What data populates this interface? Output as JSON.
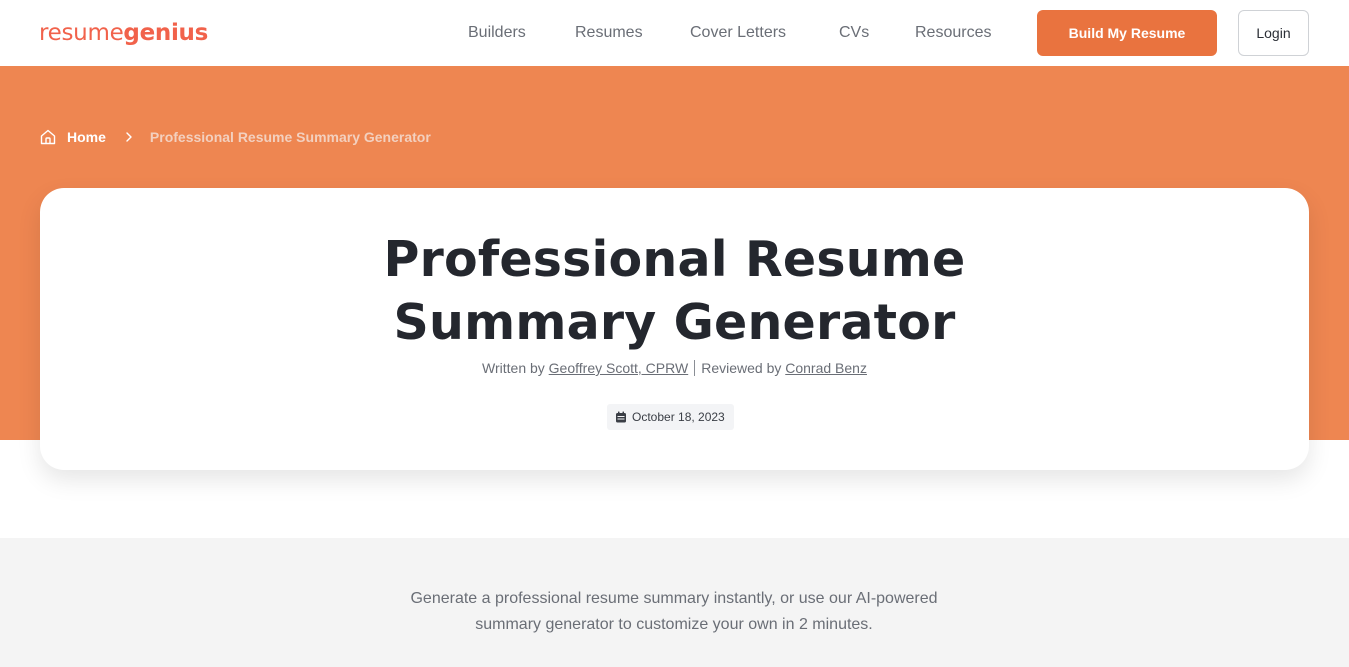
{
  "header": {
    "logo": {
      "part1": "resume",
      "part2": "genius"
    },
    "nav": [
      {
        "label": "Builders"
      },
      {
        "label": "Resumes"
      },
      {
        "label": "Cover Letters"
      },
      {
        "label": "CVs"
      },
      {
        "label": "Resources"
      }
    ],
    "cta_label": "Build My Resume",
    "login_label": "Login"
  },
  "breadcrumb": {
    "home_icon": "home-icon",
    "home_label": "Home",
    "separator_icon": "chevron-right-icon",
    "current": "Professional Resume Summary Generator"
  },
  "article": {
    "title_line1": "Professional Resume",
    "title_line2": "Summary Generator",
    "written_by_prefix": "Written by",
    "author": "Geoffrey Scott, CPRW",
    "reviewed_by_prefix": "Reviewed by",
    "reviewer": "Conrad Benz",
    "date_icon": "calendar-icon",
    "date": "October 18, 2023"
  },
  "intro": {
    "line1": "Generate a professional resume summary instantly, or use our AI-powered",
    "line2": "summary generator to customize your own in 2 minutes."
  },
  "colors": {
    "brand_logo": "#f1624b",
    "cta": "#e9733f",
    "hero_bg": "#ee8651",
    "title_text": "#24272e",
    "muted_text": "#6a6e76",
    "intro_bg": "#f4f4f4"
  }
}
